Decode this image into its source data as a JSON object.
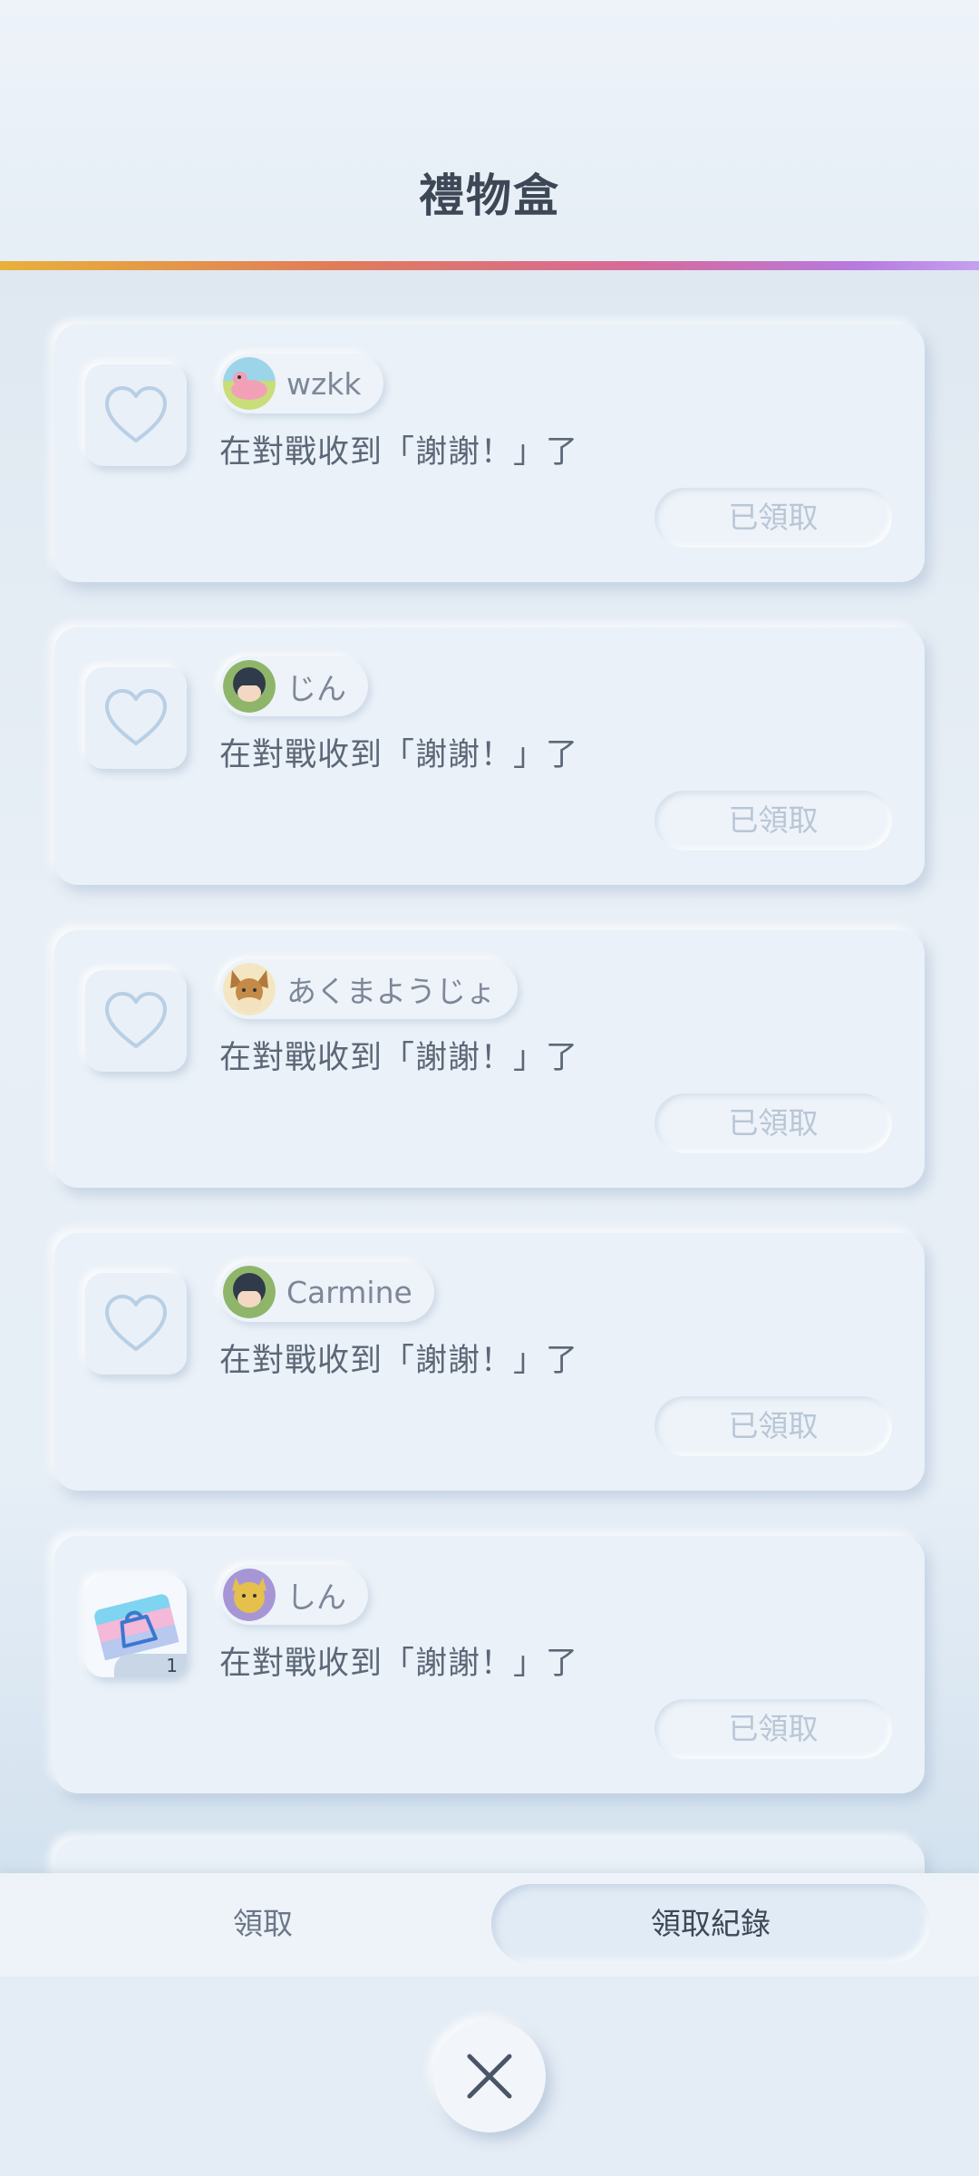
{
  "header": {
    "title": "禮物盒"
  },
  "gifts": [
    {
      "username": "wzkk",
      "message": "在對戰收到「謝謝！」了",
      "status": "已領取",
      "icon": "heart-icon",
      "avatar": "pink-creature-avatar"
    },
    {
      "username": "じん",
      "message": "在對戰收到「謝謝！」了",
      "status": "已領取",
      "icon": "heart-icon",
      "avatar": "dark-hair-trainer-avatar"
    },
    {
      "username": "あくまようじょ",
      "message": "在對戰收到「謝謝！」了",
      "status": "已領取",
      "icon": "heart-icon",
      "avatar": "eevee-avatar"
    },
    {
      "username": "Carmine",
      "message": "在對戰收到「謝謝！」了",
      "status": "已領取",
      "icon": "heart-icon",
      "avatar": "dark-hair-trainer-avatar"
    },
    {
      "username": "しん",
      "message": "在對戰收到「謝謝！」了",
      "status": "已領取",
      "icon": "shopping-bag-ticket-icon",
      "quantity": "1",
      "avatar": "yellow-creature-avatar"
    }
  ],
  "tabs": {
    "claim_label": "領取",
    "history_label": "領取紀錄"
  },
  "colors": {
    "accent_gradient": [
      "#e8b13a",
      "#e07b5a",
      "#d66a9a",
      "#b77ae0"
    ],
    "background": "#e4edf5",
    "card": "#eaf1f8",
    "heart_outline": "#b8cfe6"
  }
}
